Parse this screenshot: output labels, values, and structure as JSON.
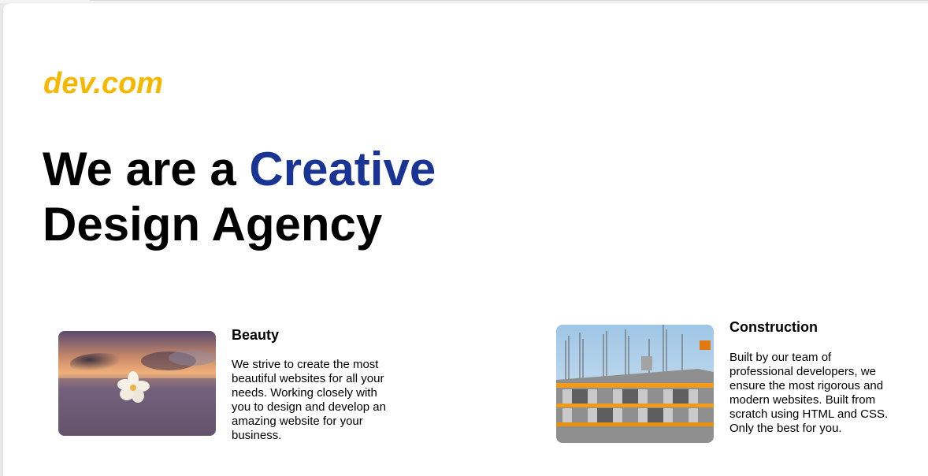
{
  "brand": {
    "name": "dev.com",
    "color": "#f5b800"
  },
  "hero": {
    "line1_prefix": "We are a ",
    "line1_accent": "Creative",
    "line2": "Design Agency",
    "accent_color": "#1a3494"
  },
  "services": [
    {
      "title": "Beauty",
      "description": "We strive to create the most beautiful websites for all your needs. Working closely with you to design and develop an amazing website for your business.",
      "image": "beach-flower-photo"
    },
    {
      "title": "Construction",
      "description": "Built by our team of professional developers, we ensure the most rigorous and modern websites. Built from scratch using HTML and CSS. Only the best for you.",
      "image": "building-construction-photo"
    }
  ]
}
